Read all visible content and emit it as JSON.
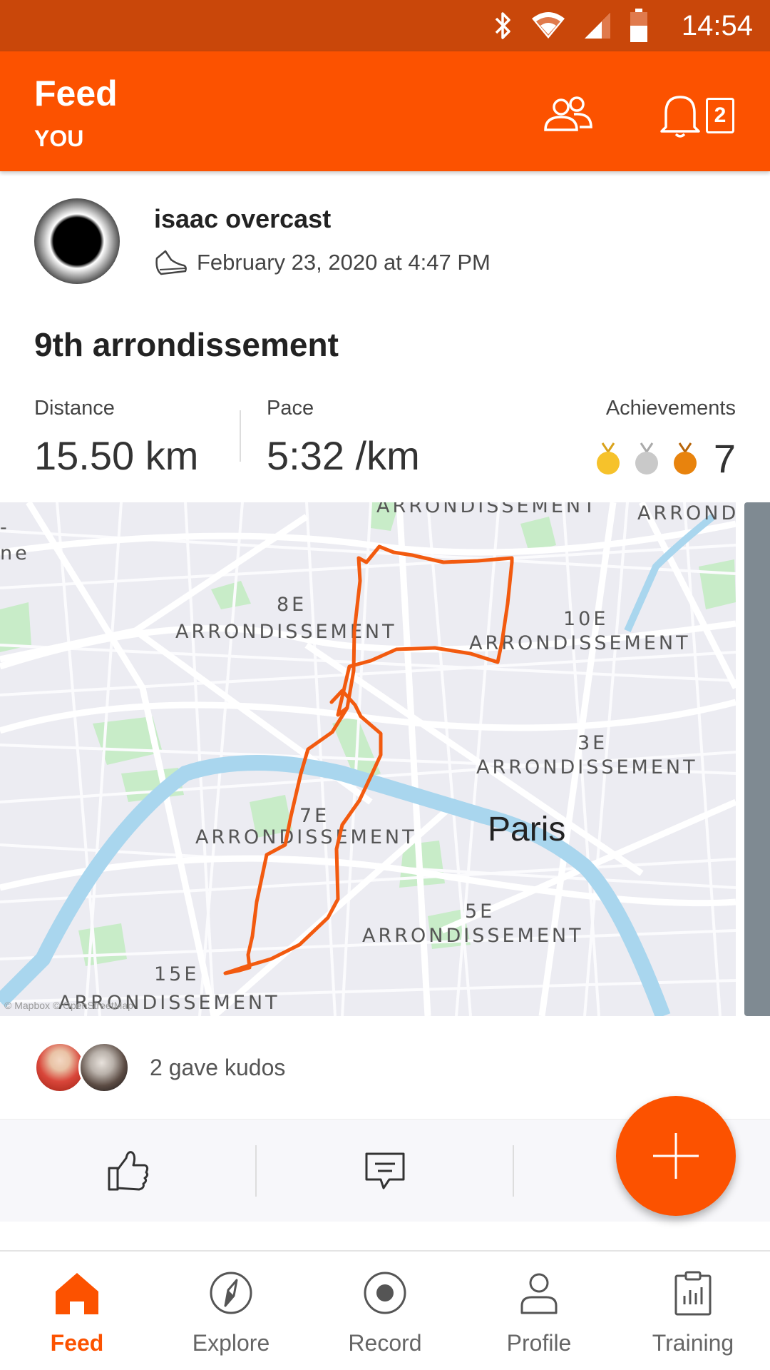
{
  "status_bar": {
    "time": "14:54",
    "icons": [
      "bluetooth-icon",
      "wifi-icon",
      "signal-icon",
      "battery-icon"
    ]
  },
  "header": {
    "title": "Feed",
    "subtitle": "YOU",
    "notification_count": "2"
  },
  "activity": {
    "athlete_name": "isaac overcast",
    "datetime": "February 23, 2020 at 4:47 PM",
    "type_icon": "run-shoe-icon",
    "title": "9th arrondissement",
    "stats": {
      "distance_label": "Distance",
      "distance_value": "15.50 km",
      "pace_label": "Pace",
      "pace_value": "5:32 /km",
      "achievements_label": "Achievements",
      "achievements_count": "7"
    },
    "medals": [
      "#f6c22b",
      "#c9c9c9",
      "#e8830d"
    ],
    "map": {
      "labels": {
        "arr_top": "ARRONDISSEMENT",
        "arr_top_right": "ARROND",
        "arr_8_num": "8E",
        "arr_8": "ARRONDISSEMENT",
        "arr_10_num": "10E",
        "arr_10": "ARRONDISSEMENT",
        "arr_3_num": "3E",
        "arr_3": "ARRONDISSEMENT",
        "arr_7_num": "7E",
        "arr_7": "ARRONDISSEMENT",
        "city": "Paris",
        "arr_5_num": "5E",
        "arr_5": "ARRONDISSEMENT",
        "arr_15_num": "15E",
        "arr_15": "ARRONDISSEMENT",
        "edge_top": "-",
        "edge_mid": "ne",
        "attribution": "© Mapbox © OpenStreetMap"
      },
      "route_color": "#f25a0f",
      "water_color": "#a9d6ee",
      "park_color": "#c8ecc8"
    },
    "kudos_text": "2 gave kudos"
  },
  "actions": {
    "kudos_icon": "thumbs-up-icon",
    "comment_icon": "comment-icon",
    "fab_icon": "plus-icon"
  },
  "nav": [
    {
      "label": "Feed",
      "icon": "home-icon",
      "active": true
    },
    {
      "label": "Explore",
      "icon": "compass-icon",
      "active": false
    },
    {
      "label": "Record",
      "icon": "record-icon",
      "active": false
    },
    {
      "label": "Profile",
      "icon": "profile-icon",
      "active": false
    },
    {
      "label": "Training",
      "icon": "training-icon",
      "active": false
    }
  ],
  "colors": {
    "brand": "#fc5200",
    "status_bar": "#c9470a"
  }
}
